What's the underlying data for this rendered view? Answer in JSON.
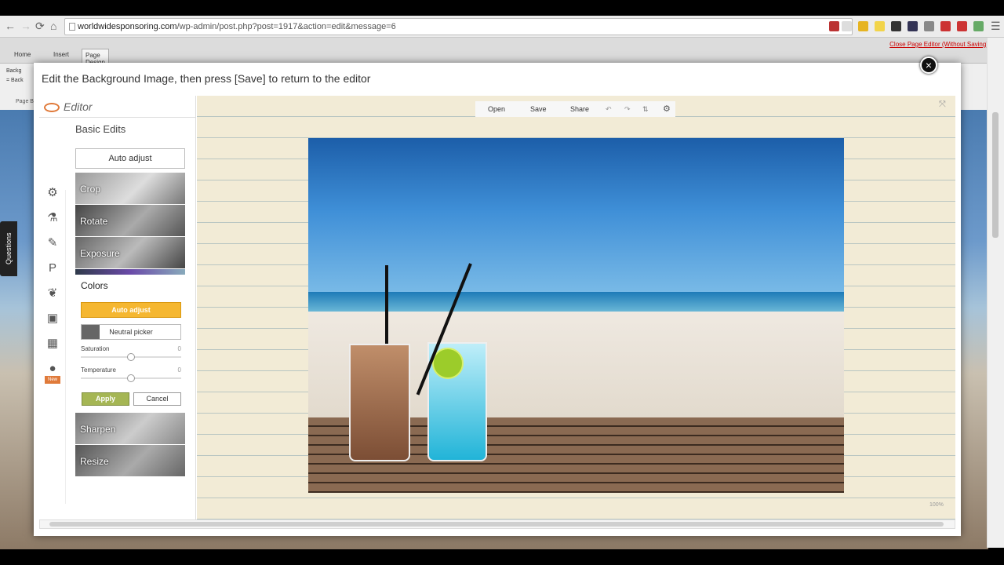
{
  "browser": {
    "url_domain": "worldwidesponsoring.com",
    "url_path": "/wp-admin/post.php?post=1917&action=edit&message=6",
    "back_icon": "←",
    "forward_icon": "→",
    "reload_icon": "⟳",
    "home_icon": "⌂",
    "menu_icon": "☰"
  },
  "ribbon": {
    "tabs": [
      "Home",
      "Insert",
      "Page Design"
    ],
    "close_link": "Close Page Editor (Without Saving)",
    "snippets": [
      "Backg",
      "= Back",
      "Page B"
    ]
  },
  "questions_tab": "Questions",
  "modal": {
    "title": "Edit the Background Image, then press [Save] to return to the editor",
    "close_icon": "×"
  },
  "editor": {
    "logo_text": "Editor",
    "section_title": "Basic Edits",
    "auto_adjust": "Auto adjust",
    "tiles": [
      "Crop",
      "Rotate",
      "Exposure",
      "Sharpen",
      "Resize"
    ],
    "colors": {
      "title": "Colors",
      "auto_adjust": "Auto adjust",
      "neutral_picker": "Neutral picker",
      "saturation_label": "Saturation",
      "saturation_value": "0",
      "temperature_label": "Temperature",
      "temperature_value": "0",
      "apply": "Apply",
      "cancel": "Cancel"
    },
    "new_badge": "New"
  },
  "canvas": {
    "toolbar": [
      "Open",
      "Save",
      "Share"
    ],
    "zoom_text": "100%",
    "close_icon": "⤧"
  },
  "colors": {
    "accent_yellow": "#f5b731",
    "apply_green": "#a5b654",
    "canvas_bg": "#f2ebd6"
  }
}
